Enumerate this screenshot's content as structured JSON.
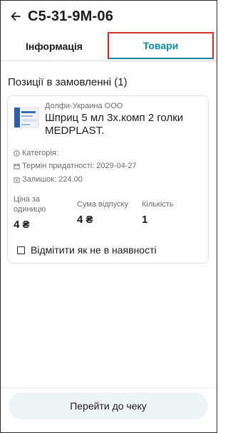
{
  "header": {
    "title": "С5-31-9М-06",
    "back_icon": "arrow-left-icon"
  },
  "tabs": [
    {
      "label": "Інформація",
      "active": false
    },
    {
      "label": "Товари",
      "active": true
    }
  ],
  "colors": {
    "accent": "#0f8a9e",
    "highlight_border": "#d32c2c",
    "button_bg": "#eef3f5"
  },
  "section": {
    "title": "Позиції в замовленні (1)"
  },
  "item": {
    "supplier": "Долфи-Украина ООО",
    "name": "Шприц 5 мл 3х.комп 2 голки MEDPLAST.",
    "category_label": "Категорія:",
    "expiry_label": "Термін придатності: 2029-04-27",
    "stock_label": "Залишок: 224.00",
    "unit_price_label": "Ціна за одиницю",
    "unit_price_value": "4 ₴",
    "sum_label": "Сума відпуску",
    "sum_value": "4 ₴",
    "qty_label": "Кількість",
    "qty_value": "1",
    "not_available_label": "Відмітити як не в наявності",
    "not_available_checked": false
  },
  "footer": {
    "checkout_label": "Перейти до чеку"
  }
}
